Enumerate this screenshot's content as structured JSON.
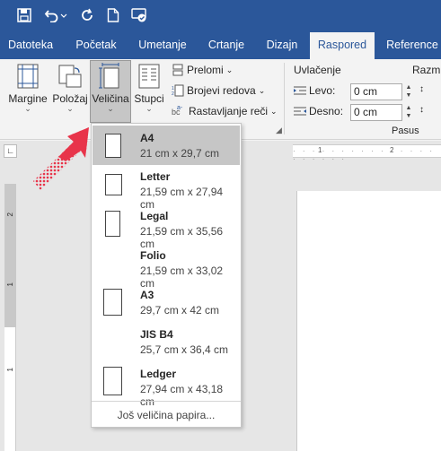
{
  "qat": {
    "icons": [
      "save-icon",
      "undo-icon",
      "redo-icon",
      "new-document-icon",
      "touch-mode-icon"
    ]
  },
  "tabs": [
    "Datoteka",
    "Početak",
    "Umetanje",
    "Crtanje",
    "Dizajn",
    "Raspored",
    "Reference"
  ],
  "active_tab": "Raspored",
  "ribbon": {
    "margins": "Margine",
    "orientation": "Položaj",
    "size": "Veličina",
    "columns": "Stupci",
    "breaks": "Prelomi",
    "line_numbers": "Brojevi redova",
    "hyphenation": "Rastavljanje reči",
    "indent_title": "Uvlačenje",
    "indent_left_label": "Levo:",
    "indent_left_value": "0 cm",
    "indent_right_label": "Desno:",
    "indent_right_value": "0 cm",
    "spacing_title": "Razm",
    "paragraph_group": "Pasus"
  },
  "ruler": {
    "ticks": [
      "1",
      "2"
    ],
    "left_ticks": [
      "2",
      "1",
      "1"
    ]
  },
  "dropdown": {
    "items": [
      {
        "name": "A4",
        "size": "21 cm x 29,7 cm",
        "selected": true
      },
      {
        "name": "Letter",
        "size": "21,59 cm x 27,94 cm"
      },
      {
        "name": "Legal",
        "size": "21,59 cm x 35,56 cm"
      },
      {
        "name": "Folio",
        "size": "21,59 cm x 33,02 cm"
      },
      {
        "name": "A3",
        "size": "29,7 cm x 42 cm"
      },
      {
        "name": "JIS B4",
        "size": "25,7 cm x 36,4 cm"
      },
      {
        "name": "Ledger",
        "size": "27,94 cm x 43,18 cm"
      }
    ],
    "more": "Još veličina papira..."
  },
  "colors": {
    "accent": "#2b579a",
    "arrow": "#e8344a",
    "selected": "#c6c6c6"
  }
}
